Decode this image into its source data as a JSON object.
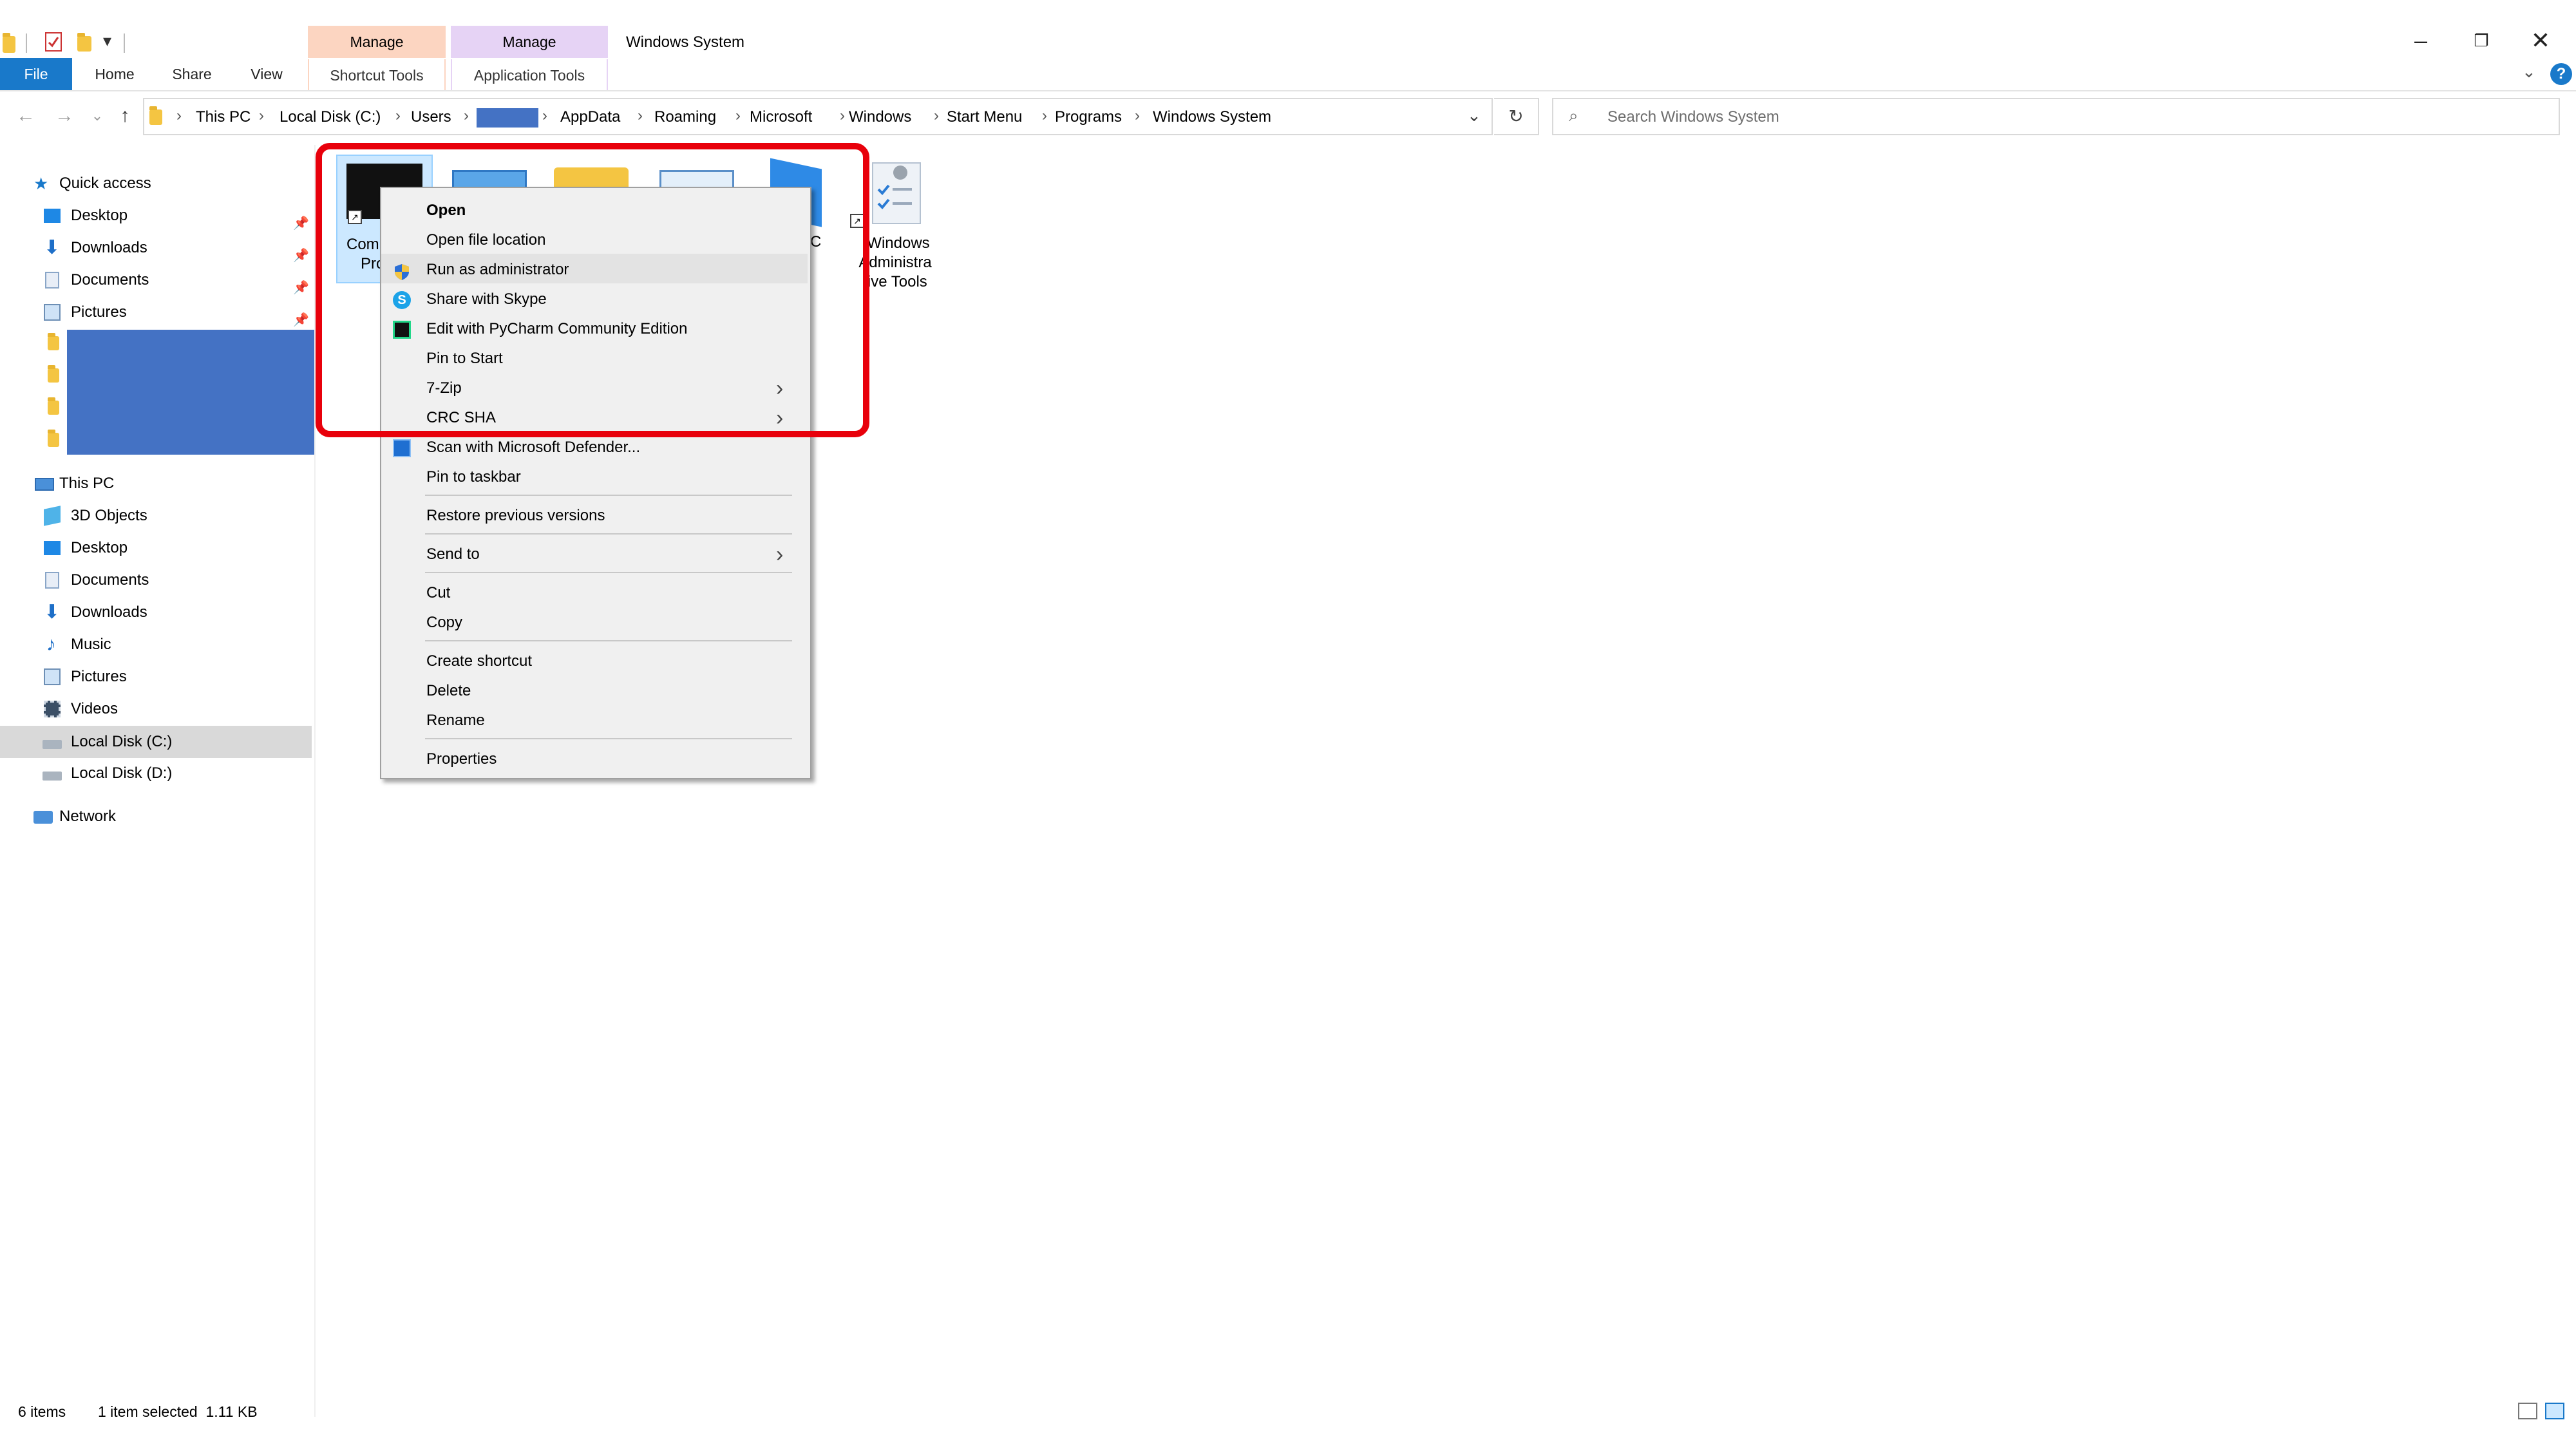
{
  "window": {
    "title": "Windows System"
  },
  "ribbon": {
    "file": "File",
    "tabs": [
      "Home",
      "Share",
      "View"
    ],
    "context_groups": [
      {
        "header": "Manage",
        "tab": "Shortcut Tools",
        "color": "#fcd5c1"
      },
      {
        "header": "Manage",
        "tab": "Application Tools",
        "color": "#e6d3f5"
      }
    ],
    "help": "?"
  },
  "address": {
    "crumbs": [
      "This PC",
      "Local Disk (C:)",
      "Users",
      "",
      "AppData",
      "Roaming",
      "Microsoft",
      "Windows",
      "Start Menu",
      "Programs",
      "Windows System"
    ],
    "redacted_color": "#4472c4"
  },
  "search": {
    "placeholder": "Search Windows System"
  },
  "nav": {
    "quick_access": "Quick access",
    "quick_items": [
      "Desktop",
      "Downloads",
      "Documents",
      "Pictures"
    ],
    "this_pc": "This PC",
    "pc_items": [
      "3D Objects",
      "Desktop",
      "Documents",
      "Downloads",
      "Music",
      "Pictures",
      "Videos",
      "Local Disk (C:)",
      "Local Disk (D:)"
    ],
    "network": "Network",
    "redacted_color": "#4472c4"
  },
  "items": {
    "first_partial": [
      "Com",
      "Pro"
    ],
    "last_label": [
      "Windows",
      "Administra",
      "tive Tools"
    ],
    "third_partial": "C"
  },
  "context_menu": {
    "items": [
      {
        "label": "Open",
        "bold": true
      },
      {
        "label": "Open file location"
      },
      {
        "label": "Run as administrator",
        "icon": "shield-icon"
      },
      {
        "label": "Share with Skype",
        "icon": "skype-icon"
      },
      {
        "label": "Edit with PyCharm Community Edition",
        "icon": "pycharm-icon"
      },
      {
        "label": "Pin to Start"
      },
      {
        "label": "7-Zip",
        "submenu": true
      },
      {
        "label": "CRC SHA",
        "submenu": true
      },
      {
        "label": "Scan with Microsoft Defender...",
        "icon": "defender-icon"
      },
      {
        "label": "Pin to taskbar"
      },
      {
        "label": "Restore previous versions"
      },
      {
        "label": "Send to",
        "submenu": true
      },
      {
        "label": "Cut"
      },
      {
        "label": "Copy"
      },
      {
        "label": "Create shortcut"
      },
      {
        "label": "Delete"
      },
      {
        "label": "Rename"
      },
      {
        "label": "Properties"
      }
    ]
  },
  "highlight": {
    "color": "#e8000b"
  },
  "status": {
    "count": "6 items",
    "selection": "1 item selected  1.11 KB"
  }
}
